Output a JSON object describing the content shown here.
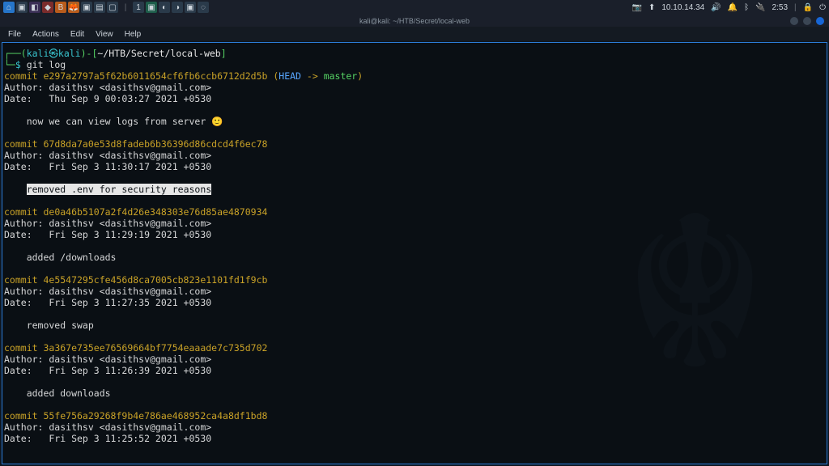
{
  "panel": {
    "ip": "10.10.14.34",
    "time": "2:53"
  },
  "window": {
    "title": "kali@kali: ~/HTB/Secret/local-web"
  },
  "menu": {
    "file": "File",
    "actions": "Actions",
    "edit": "Edit",
    "view": "View",
    "help": "Help"
  },
  "prompt": {
    "p1_open": "┌──(",
    "user": "kali",
    "at": "㉿",
    "host": "kali",
    "p1_close": ")-[",
    "path": "~/HTB/Secret/local-web",
    "p1_end": "]",
    "p2": "└─",
    "dollar": "$",
    "cmd": " git log"
  },
  "log": {
    "c1_l": "commit ",
    "c1_h": "e297a2797a5f62b6011654cf6fb6ccb6712d2d5b",
    "c1_po": " (",
    "c1_head": "HEAD ",
    "c1_arrow": "-> ",
    "c1_master": "master",
    "c1_pc": ")",
    "c1_auth": "Author: dasithsv <dasithsv@gmail.com>",
    "c1_date": "Date:   Thu Sep 9 00:03:27 2021 +0530",
    "c1_msg": "    now we can view logs from server 🙂",
    "c2_l": "commit ",
    "c2_h": "67d8da7a0e53d8fadeb6b36396d86cdcd4f6ec78",
    "c2_auth": "Author: dasithsv <dasithsv@gmail.com>",
    "c2_date": "Date:   Fri Sep 3 11:30:17 2021 +0530",
    "c2_msg_pre": "    ",
    "c2_msg_hl": "removed .env for security reasons",
    "c3_l": "commit ",
    "c3_h": "de0a46b5107a2f4d26e348303e76d85ae4870934",
    "c3_auth": "Author: dasithsv <dasithsv@gmail.com>",
    "c3_date": "Date:   Fri Sep 3 11:29:19 2021 +0530",
    "c3_msg": "    added /downloads",
    "c4_l": "commit ",
    "c4_h": "4e5547295cfe456d8ca7005cb823e1101fd1f9cb",
    "c4_auth": "Author: dasithsv <dasithsv@gmail.com>",
    "c4_date": "Date:   Fri Sep 3 11:27:35 2021 +0530",
    "c4_msg": "    removed swap",
    "c5_l": "commit ",
    "c5_h": "3a367e735ee76569664bf7754eaaade7c735d702",
    "c5_auth": "Author: dasithsv <dasithsv@gmail.com>",
    "c5_date": "Date:   Fri Sep 3 11:26:39 2021 +0530",
    "c5_msg": "    added downloads",
    "c6_l": "commit ",
    "c6_h": "55fe756a29268f9b4e786ae468952ca4a8df1bd8",
    "c6_auth": "Author: dasithsv <dasithsv@gmail.com>",
    "c6_date": "Date:   Fri Sep 3 11:25:52 2021 +0530"
  }
}
